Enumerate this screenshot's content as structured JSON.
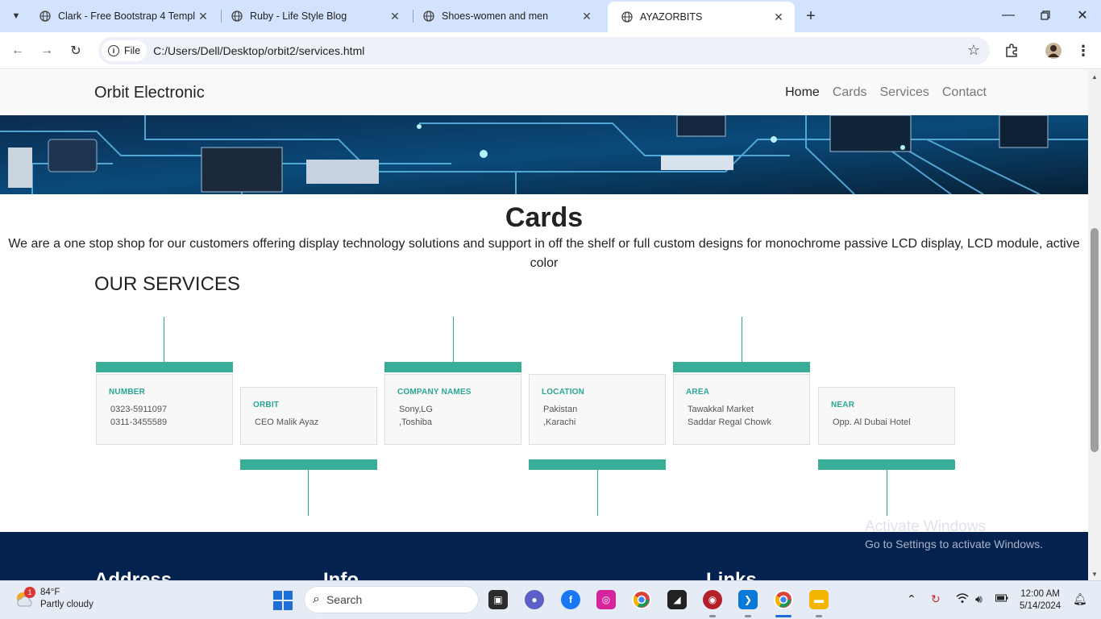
{
  "browser": {
    "tabs": [
      {
        "title": "Clark - Free Bootstrap 4 Templa",
        "active": false
      },
      {
        "title": "Ruby - Life Style Blog",
        "active": false
      },
      {
        "title": "Shoes-women and men",
        "active": false
      },
      {
        "title": "AYAZORBITS",
        "active": true
      }
    ],
    "site_chip": "File",
    "url": "C:/Users/Dell/Desktop/orbit2/services.html"
  },
  "site": {
    "brand": "Orbit Electronic",
    "nav": [
      "Home",
      "Cards",
      "Services",
      "Contact"
    ],
    "active_nav": "Home"
  },
  "main": {
    "title": "Cards",
    "intro": "We are a one stop shop for our customers offering display technology solutions and support in off the shelf or full custom designs for monochrome passive LCD display, LCD module, active color",
    "services_heading": "OUR SERVICES",
    "services": [
      {
        "title": "NUMBER",
        "lines": [
          "0323-5911097",
          "0311-3455589"
        ],
        "position": "top"
      },
      {
        "title": "ORBIT",
        "lines": [
          "CEO Malik Ayaz"
        ],
        "position": "bottom"
      },
      {
        "title": "COMPANY NAMES",
        "lines": [
          "Sony,LG",
          ",Toshiba"
        ],
        "position": "top"
      },
      {
        "title": "LOCATION",
        "lines": [
          "Pakistan",
          ",Karachi"
        ],
        "position": "bottom"
      },
      {
        "title": "AREA",
        "lines": [
          "Tawakkal Market",
          "Saddar Regal Chowk"
        ],
        "position": "top"
      },
      {
        "title": "NEAR",
        "lines": [
          "Opp. Al Dubai Hotel"
        ],
        "position": "bottom"
      }
    ],
    "accent_color": "#39ad98"
  },
  "footer": {
    "headings": [
      "Address",
      "Info",
      "Links"
    ],
    "bg_color": "#04224f"
  },
  "activation": {
    "line1": "Activate Windows",
    "line2": "Go to Settings to activate Windows."
  },
  "taskbar": {
    "weather": {
      "temp": "84°F",
      "desc": "Partly cloudy",
      "badge": "1"
    },
    "search_placeholder": "Search",
    "clock": {
      "time": "12:00 AM",
      "date": "5/14/2024"
    }
  }
}
